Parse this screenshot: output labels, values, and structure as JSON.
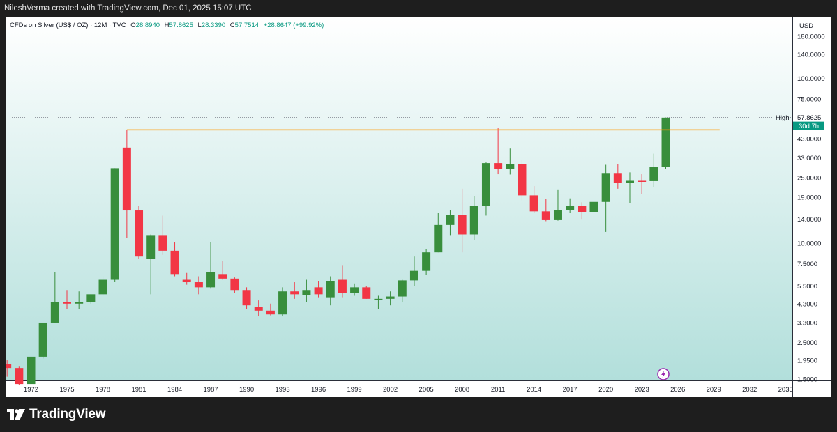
{
  "header": {
    "attribution": "NileshVerma created with TradingView.com, Dec 01, 2025 15:07 UTC"
  },
  "legend": {
    "symbol": "CFDs on Silver (US$ / OZ) · 12M · TVC",
    "open_label": "O",
    "open_value": "28.8940",
    "high_label": "H",
    "high_value": "57.8625",
    "low_label": "L",
    "low_value": "28.3390",
    "close_label": "C",
    "close_value": "57.7514",
    "change": "+28.8647 (+99.92%)"
  },
  "price_axis": {
    "currency": "USD",
    "high_label": "High",
    "high_value": "57.8625",
    "countdown": "30d 7h"
  },
  "footer": {
    "brand": "TradingView"
  },
  "colors": {
    "up": "#388e3c",
    "down": "#f23645",
    "resistance": "#ff9800",
    "countdown_bg": "#089981",
    "gradient_top": "#ffffff",
    "gradient_bottom": "#b2dfdb"
  },
  "chart_data": {
    "type": "candlestick",
    "scale": "log",
    "y_ticks": [
      "180.0000",
      "140.0000",
      "100.0000",
      "75.0000",
      "43.0000",
      "33.0000",
      "25.0000",
      "19.0000",
      "14.0000",
      "10.0000",
      "7.5000",
      "5.5000",
      "4.3000",
      "3.3000",
      "2.5000",
      "1.9500",
      "1.5000"
    ],
    "x_ticks": [
      "1972",
      "1975",
      "1978",
      "1981",
      "1984",
      "1987",
      "1990",
      "1993",
      "1996",
      "1999",
      "2002",
      "2005",
      "2008",
      "2011",
      "2014",
      "2017",
      "2020",
      "2023",
      "2026",
      "2029",
      "2032",
      "2035"
    ],
    "resistance_level": 48.7,
    "candles": [
      {
        "year": 1970,
        "o": 1.85,
        "h": 1.95,
        "l": 1.55,
        "c": 1.75
      },
      {
        "year": 1971,
        "o": 1.75,
        "h": 1.8,
        "l": 1.38,
        "c": 1.4
      },
      {
        "year": 1972,
        "o": 1.4,
        "h": 2.05,
        "l": 1.4,
        "c": 2.05
      },
      {
        "year": 1973,
        "o": 2.05,
        "h": 3.3,
        "l": 2.0,
        "c": 3.3
      },
      {
        "year": 1974,
        "o": 3.3,
        "h": 6.7,
        "l": 3.3,
        "c": 4.4
      },
      {
        "year": 1975,
        "o": 4.4,
        "h": 5.2,
        "l": 4.0,
        "c": 4.3
      },
      {
        "year": 1976,
        "o": 4.3,
        "h": 5.1,
        "l": 4.0,
        "c": 4.4
      },
      {
        "year": 1977,
        "o": 4.4,
        "h": 4.9,
        "l": 4.3,
        "c": 4.9
      },
      {
        "year": 1978,
        "o": 4.9,
        "h": 6.3,
        "l": 4.8,
        "c": 6.0
      },
      {
        "year": 1979,
        "o": 6.0,
        "h": 28.5,
        "l": 5.8,
        "c": 28.5
      },
      {
        "year": 1980,
        "o": 38.0,
        "h": 48.7,
        "l": 10.8,
        "c": 15.8
      },
      {
        "year": 1981,
        "o": 15.8,
        "h": 16.8,
        "l": 8.0,
        "c": 8.3
      },
      {
        "year": 1982,
        "o": 8.0,
        "h": 11.3,
        "l": 4.9,
        "c": 11.2
      },
      {
        "year": 1983,
        "o": 11.2,
        "h": 14.7,
        "l": 8.5,
        "c": 9.0
      },
      {
        "year": 1984,
        "o": 9.0,
        "h": 10.1,
        "l": 6.3,
        "c": 6.5
      },
      {
        "year": 1985,
        "o": 6.0,
        "h": 6.6,
        "l": 5.6,
        "c": 5.8
      },
      {
        "year": 1986,
        "o": 5.8,
        "h": 6.3,
        "l": 4.9,
        "c": 5.4
      },
      {
        "year": 1987,
        "o": 5.4,
        "h": 10.2,
        "l": 5.3,
        "c": 6.7
      },
      {
        "year": 1988,
        "o": 6.5,
        "h": 7.8,
        "l": 6.0,
        "c": 6.1
      },
      {
        "year": 1989,
        "o": 6.1,
        "h": 6.2,
        "l": 5.0,
        "c": 5.2
      },
      {
        "year": 1990,
        "o": 5.2,
        "h": 5.4,
        "l": 4.0,
        "c": 4.2
      },
      {
        "year": 1991,
        "o": 4.1,
        "h": 4.5,
        "l": 3.6,
        "c": 3.9
      },
      {
        "year": 1992,
        "o": 3.9,
        "h": 4.3,
        "l": 3.65,
        "c": 3.7
      },
      {
        "year": 1993,
        "o": 3.7,
        "h": 5.4,
        "l": 3.6,
        "c": 5.1
      },
      {
        "year": 1994,
        "o": 5.1,
        "h": 5.8,
        "l": 4.6,
        "c": 4.9
      },
      {
        "year": 1995,
        "o": 4.85,
        "h": 6.0,
        "l": 4.4,
        "c": 5.2
      },
      {
        "year": 1996,
        "o": 5.4,
        "h": 5.9,
        "l": 4.7,
        "c": 4.9
      },
      {
        "year": 1997,
        "o": 4.7,
        "h": 6.3,
        "l": 4.2,
        "c": 5.9
      },
      {
        "year": 1998,
        "o": 6.0,
        "h": 7.3,
        "l": 4.7,
        "c": 5.0
      },
      {
        "year": 1999,
        "o": 5.0,
        "h": 5.7,
        "l": 4.8,
        "c": 5.4
      },
      {
        "year": 2000,
        "o": 5.4,
        "h": 5.5,
        "l": 4.6,
        "c": 4.6
      },
      {
        "year": 2001,
        "o": 4.6,
        "h": 4.8,
        "l": 4.0,
        "c": 4.6
      },
      {
        "year": 2002,
        "o": 4.6,
        "h": 5.1,
        "l": 4.2,
        "c": 4.75
      },
      {
        "year": 2003,
        "o": 4.75,
        "h": 6.0,
        "l": 4.4,
        "c": 5.95
      },
      {
        "year": 2004,
        "o": 5.95,
        "h": 8.3,
        "l": 5.5,
        "c": 6.8
      },
      {
        "year": 2005,
        "o": 6.8,
        "h": 9.2,
        "l": 6.4,
        "c": 8.8
      },
      {
        "year": 2006,
        "o": 8.8,
        "h": 15.2,
        "l": 8.8,
        "c": 12.9
      },
      {
        "year": 2007,
        "o": 12.9,
        "h": 15.8,
        "l": 11.2,
        "c": 14.8
      },
      {
        "year": 2008,
        "o": 14.8,
        "h": 21.4,
        "l": 8.8,
        "c": 11.3
      },
      {
        "year": 2009,
        "o": 11.3,
        "h": 19.2,
        "l": 10.5,
        "c": 16.9
      },
      {
        "year": 2010,
        "o": 16.9,
        "h": 30.9,
        "l": 14.7,
        "c": 30.6
      },
      {
        "year": 2011,
        "o": 30.6,
        "h": 49.8,
        "l": 26.2,
        "c": 28.2
      },
      {
        "year": 2012,
        "o": 28.2,
        "h": 37.5,
        "l": 26.1,
        "c": 30.2
      },
      {
        "year": 2013,
        "o": 30.2,
        "h": 32.2,
        "l": 18.2,
        "c": 19.5
      },
      {
        "year": 2014,
        "o": 19.5,
        "h": 22.2,
        "l": 15.3,
        "c": 15.6
      },
      {
        "year": 2015,
        "o": 15.6,
        "h": 18.5,
        "l": 13.6,
        "c": 13.8
      },
      {
        "year": 2016,
        "o": 13.8,
        "h": 21.2,
        "l": 13.7,
        "c": 15.9
      },
      {
        "year": 2017,
        "o": 15.9,
        "h": 18.7,
        "l": 15.2,
        "c": 16.9
      },
      {
        "year": 2018,
        "o": 16.9,
        "h": 17.7,
        "l": 13.9,
        "c": 15.5
      },
      {
        "year": 2019,
        "o": 15.5,
        "h": 19.6,
        "l": 14.3,
        "c": 17.8
      },
      {
        "year": 2020,
        "o": 17.8,
        "h": 29.9,
        "l": 11.7,
        "c": 26.4
      },
      {
        "year": 2021,
        "o": 26.4,
        "h": 30.1,
        "l": 21.4,
        "c": 23.3
      },
      {
        "year": 2022,
        "o": 23.3,
        "h": 26.9,
        "l": 17.6,
        "c": 23.9
      },
      {
        "year": 2023,
        "o": 23.9,
        "h": 26.2,
        "l": 19.9,
        "c": 23.8
      },
      {
        "year": 2024,
        "o": 23.8,
        "h": 34.9,
        "l": 21.9,
        "c": 28.9
      },
      {
        "year": 2025,
        "o": 28.894,
        "h": 57.8625,
        "l": 28.339,
        "c": 57.7514
      }
    ]
  }
}
